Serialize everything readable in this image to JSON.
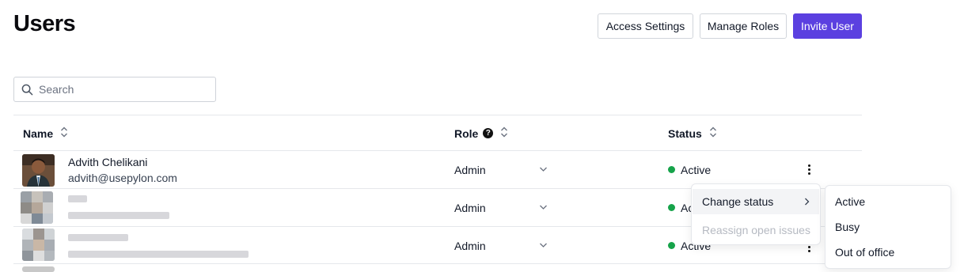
{
  "page": {
    "title": "Users"
  },
  "toolbar": {
    "access_settings_label": "Access Settings",
    "manage_roles_label": "Manage Roles",
    "invite_user_label": "Invite User",
    "invite_color": "#5b40e0"
  },
  "search": {
    "placeholder": "Search",
    "value": ""
  },
  "table": {
    "columns": {
      "name": "Name",
      "role": "Role",
      "status": "Status"
    },
    "rows": [
      {
        "name": "Advith Chelikani",
        "email": "advith@usepylon.com",
        "role": "Admin",
        "status": "Active",
        "status_color": "#16a34a"
      },
      {
        "name": "",
        "email": "",
        "role": "Admin",
        "status": "Ac",
        "status_color": "#16a34a"
      },
      {
        "name": "",
        "email": "",
        "role": "Admin",
        "status": "Active",
        "status_color": "#16a34a"
      }
    ]
  },
  "context_menu": {
    "items": [
      {
        "label": "Change status",
        "disabled": false
      },
      {
        "label": "Reassign open issues",
        "disabled": true
      }
    ]
  },
  "status_submenu": {
    "options": [
      "Active",
      "Busy",
      "Out of office"
    ]
  },
  "icons": {
    "search": "search-icon",
    "sort": "sort-icon",
    "help": "help-icon",
    "chevron": "chevron-down-icon",
    "kebab": "more-vertical-icon"
  }
}
